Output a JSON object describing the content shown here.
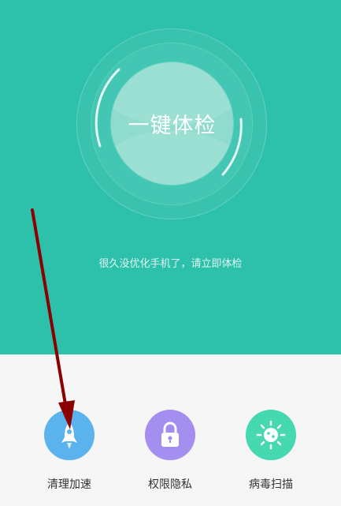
{
  "hero": {
    "main_button_label": "一键体检",
    "hint": "很久没优化手机了，请立即体检",
    "background_color": "#2dc0aa"
  },
  "tools": [
    {
      "label": "清理加速",
      "icon": "rocket-icon",
      "color": "#5bb3ee"
    },
    {
      "label": "权限隐私",
      "icon": "lock-icon",
      "color": "#a48ef0"
    },
    {
      "label": "病毒扫描",
      "icon": "virus-icon",
      "color": "#46d8b0"
    }
  ],
  "annotation": {
    "type": "arrow",
    "color": "#8b0000",
    "target": "清理加速"
  }
}
